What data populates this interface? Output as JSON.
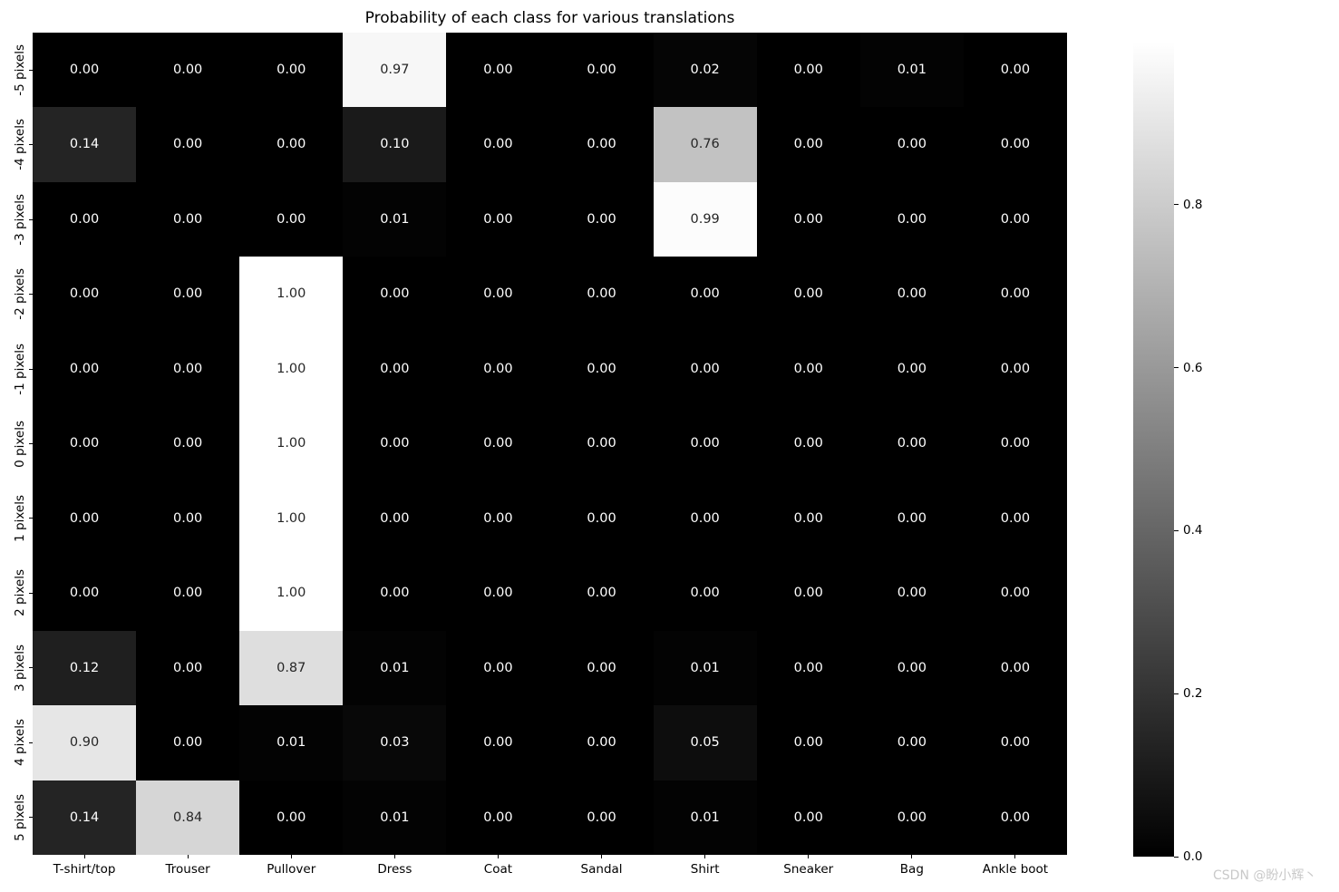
{
  "chart_data": {
    "type": "heatmap",
    "title": "Probability of each class for various translations",
    "xlabel": "",
    "ylabel": "",
    "categories": [
      "T-shirt/top",
      "Trouser",
      "Pullover",
      "Dress",
      "Coat",
      "Sandal",
      "Shirt",
      "Sneaker",
      "Bag",
      "Ankle boot"
    ],
    "rows": [
      "-5 pixels",
      "-4 pixels",
      "-3 pixels",
      "-2 pixels",
      "-1 pixels",
      "0 pixels",
      "1 pixels",
      "2 pixels",
      "3 pixels",
      "4 pixels",
      "5 pixels"
    ],
    "values": [
      [
        0.0,
        0.0,
        0.0,
        0.97,
        0.0,
        0.0,
        0.02,
        0.0,
        0.01,
        0.0
      ],
      [
        0.14,
        0.0,
        0.0,
        0.1,
        0.0,
        0.0,
        0.76,
        0.0,
        0.0,
        0.0
      ],
      [
        0.0,
        0.0,
        0.0,
        0.01,
        0.0,
        0.0,
        0.99,
        0.0,
        0.0,
        0.0
      ],
      [
        0.0,
        0.0,
        1.0,
        0.0,
        0.0,
        0.0,
        0.0,
        0.0,
        0.0,
        0.0
      ],
      [
        0.0,
        0.0,
        1.0,
        0.0,
        0.0,
        0.0,
        0.0,
        0.0,
        0.0,
        0.0
      ],
      [
        0.0,
        0.0,
        1.0,
        0.0,
        0.0,
        0.0,
        0.0,
        0.0,
        0.0,
        0.0
      ],
      [
        0.0,
        0.0,
        1.0,
        0.0,
        0.0,
        0.0,
        0.0,
        0.0,
        0.0,
        0.0
      ],
      [
        0.0,
        0.0,
        1.0,
        0.0,
        0.0,
        0.0,
        0.0,
        0.0,
        0.0,
        0.0
      ],
      [
        0.12,
        0.0,
        0.87,
        0.01,
        0.0,
        0.0,
        0.01,
        0.0,
        0.0,
        0.0
      ],
      [
        0.9,
        0.0,
        0.01,
        0.03,
        0.0,
        0.0,
        0.05,
        0.0,
        0.0,
        0.0
      ],
      [
        0.14,
        0.84,
        0.0,
        0.01,
        0.0,
        0.0,
        0.01,
        0.0,
        0.0,
        0.0
      ]
    ],
    "cell_labels": [
      [
        "0.00",
        "0.00",
        "0.00",
        "0.97",
        "0.00",
        "0.00",
        "0.02",
        "0.00",
        "0.01",
        "0.00"
      ],
      [
        "0.14",
        "0.00",
        "0.00",
        "0.10",
        "0.00",
        "0.00",
        "0.76",
        "0.00",
        "0.00",
        "0.00"
      ],
      [
        "0.00",
        "0.00",
        "0.00",
        "0.01",
        "0.00",
        "0.00",
        "0.99",
        "0.00",
        "0.00",
        "0.00"
      ],
      [
        "0.00",
        "0.00",
        "1.00",
        "0.00",
        "0.00",
        "0.00",
        "0.00",
        "0.00",
        "0.00",
        "0.00"
      ],
      [
        "0.00",
        "0.00",
        "1.00",
        "0.00",
        "0.00",
        "0.00",
        "0.00",
        "0.00",
        "0.00",
        "0.00"
      ],
      [
        "0.00",
        "0.00",
        "1.00",
        "0.00",
        "0.00",
        "0.00",
        "0.00",
        "0.00",
        "0.00",
        "0.00"
      ],
      [
        "0.00",
        "0.00",
        "1.00",
        "0.00",
        "0.00",
        "0.00",
        "0.00",
        "0.00",
        "0.00",
        "0.00"
      ],
      [
        "0.00",
        "0.00",
        "1.00",
        "0.00",
        "0.00",
        "0.00",
        "0.00",
        "0.00",
        "0.00",
        "0.00"
      ],
      [
        "0.12",
        "0.00",
        "0.87",
        "0.01",
        "0.00",
        "0.00",
        "0.01",
        "0.00",
        "0.00",
        "0.00"
      ],
      [
        "0.90",
        "0.00",
        "0.01",
        "0.03",
        "0.00",
        "0.00",
        "0.05",
        "0.00",
        "0.00",
        "0.00"
      ],
      [
        "0.14",
        "0.84",
        "0.00",
        "0.01",
        "0.00",
        "0.00",
        "0.01",
        "0.00",
        "0.00",
        "0.00"
      ]
    ],
    "colormap": "gray",
    "vmin": 0.0,
    "vmax": 1.0,
    "grid": false,
    "legend": "colorbar-right",
    "colorbar": {
      "ticks": [
        0.0,
        0.2,
        0.4,
        0.6,
        0.8
      ],
      "tick_labels": [
        "0.0",
        "0.2",
        "0.4",
        "0.6",
        "0.8"
      ],
      "min": 0.0,
      "max": 1.0
    }
  },
  "watermark": {
    "text": "CSDN @盼小辉丶"
  },
  "colors": {
    "background": "#ffffff",
    "cell_low": "#000000",
    "cell_high": "#ffffff",
    "text_on_dark": "#ffffff",
    "text_on_light": "#262626",
    "axis": "#000000",
    "watermark": "#c9c9c9"
  }
}
